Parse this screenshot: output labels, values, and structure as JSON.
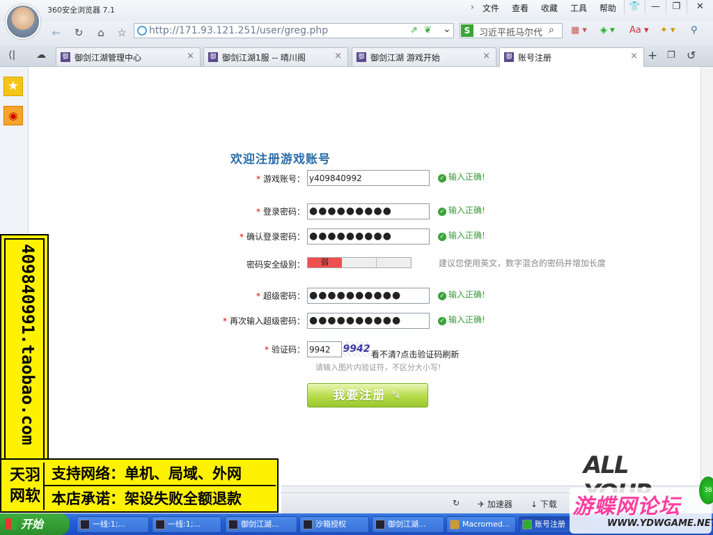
{
  "browser": {
    "app_title": "360安全浏览器 7.1",
    "menu": [
      "文件",
      "查看",
      "收藏",
      "工具",
      "帮助"
    ],
    "url": "http://171.93.121.251/user/greg.php",
    "search_text": "习近平抵马尔代",
    "tabs": [
      {
        "label": "御剑江湖管理中心",
        "icon": "御"
      },
      {
        "label": "御剑江湖1服 -- 晴川阁",
        "icon": "御"
      },
      {
        "label": "御剑江湖 游戏开始",
        "icon": "御"
      },
      {
        "label": "账号注册",
        "icon": "御"
      }
    ]
  },
  "form": {
    "heading": "欢迎注册游戏账号",
    "required_mark": "*",
    "fields": [
      {
        "label": "游戏账号：",
        "value": "y409840992",
        "status": "输入正确!"
      },
      {
        "label": "登录密码：",
        "value": "●●●●●●●●●",
        "status": "输入正确!"
      },
      {
        "label": "确认登录密码：",
        "value": "●●●●●●●●●",
        "status": "输入正确!"
      },
      {
        "label": "超级密码：",
        "value": "●●●●●●●●●●",
        "status": "输入正确!"
      },
      {
        "label": "再次输入超级密码：",
        "value": "●●●●●●●●●●",
        "status": "输入正确!"
      }
    ],
    "strength": {
      "label": "密码安全级别：",
      "level_text": "弱",
      "level": 0.33,
      "hint": "建议您使用英文，数字混合的密码并增加长度"
    },
    "captcha": {
      "label": "验证码：",
      "value": "9942",
      "image_text": "9942",
      "refresh_text": "看不清?点击验证码刷新",
      "hint": "请输入图片内验证符，不区分大小写!"
    },
    "submit_label": "我要注册"
  },
  "ad": {
    "vertical_text": "409840991.taobao.com",
    "logo_line1": "天羽",
    "logo_line2": "网软",
    "line1": "支持网络：单机、局域、外网",
    "line2": "本店承诺：架设失败全额退款"
  },
  "watermark": {
    "allyour": "ALL YOUR"
  },
  "statusbar": {
    "accelerator": "加速器",
    "download": "下载"
  },
  "taskbar": {
    "start": "开始",
    "tasks": [
      "一线:1;...",
      "一线:1;...",
      "御剑江湖...",
      "沙箱授权",
      "御剑江湖...",
      "Macromed...",
      "账号注册"
    ]
  },
  "forum": {
    "name": "游蝶网论坛",
    "url": "WWW.YDWGAME.NET"
  },
  "badge": "38"
}
